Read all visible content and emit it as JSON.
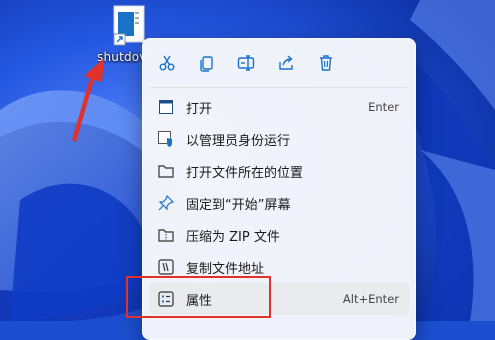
{
  "desktop": {
    "shortcut": {
      "label": "shutdov",
      "icon": "document-shortcut-icon"
    }
  },
  "colors": {
    "accent": "#e0322b",
    "menu_bg": "#f7f8fb",
    "wallpaper": "#1b4fd0",
    "icon_blue": "#1a73c9"
  },
  "menu": {
    "toolbar": [
      {
        "name": "cut",
        "icon": "scissors-icon"
      },
      {
        "name": "copy",
        "icon": "copy-icon"
      },
      {
        "name": "rename",
        "icon": "rename-icon"
      },
      {
        "name": "share",
        "icon": "share-icon"
      },
      {
        "name": "delete",
        "icon": "trash-icon"
      }
    ],
    "items": [
      {
        "label": "打开",
        "shortcut": "Enter",
        "icon": "open-app-icon"
      },
      {
        "label": "以管理员身份运行",
        "shortcut": "",
        "icon": "admin-shield-icon"
      },
      {
        "label": "打开文件所在的位置",
        "shortcut": "",
        "icon": "folder-icon"
      },
      {
        "label": "固定到“开始”屏幕",
        "shortcut": "",
        "icon": "pin-icon"
      },
      {
        "label": "压缩为 ZIP 文件",
        "shortcut": "",
        "icon": "zip-folder-icon"
      },
      {
        "label": "复制文件地址",
        "shortcut": "",
        "icon": "copy-path-icon"
      },
      {
        "label": "属性",
        "shortcut": "Alt+Enter",
        "icon": "properties-icon"
      }
    ]
  }
}
